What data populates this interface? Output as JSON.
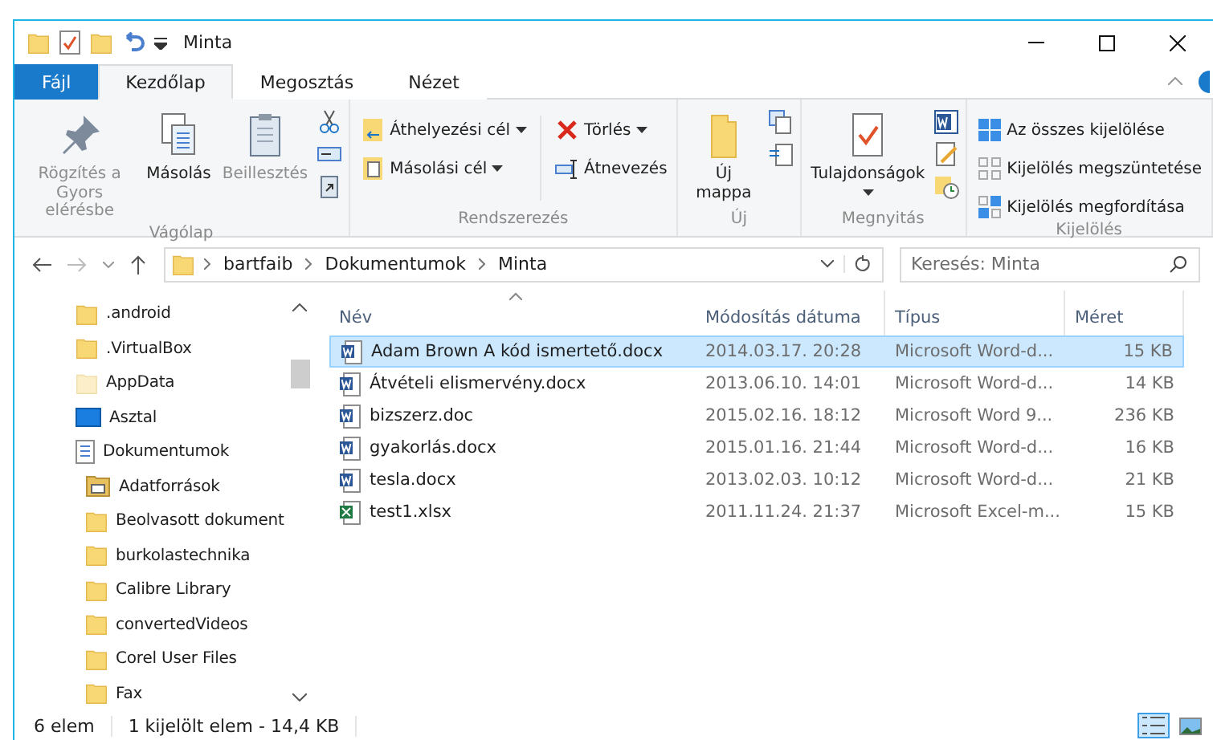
{
  "window": {
    "title": "Minta"
  },
  "tabs": [
    {
      "label": "Fájl",
      "kind": "file",
      "selected": false
    },
    {
      "label": "Kezdőlap",
      "kind": "tab",
      "selected": true
    },
    {
      "label": "Megosztás",
      "kind": "tab",
      "selected": false
    },
    {
      "label": "Nézet",
      "kind": "tab",
      "selected": false
    }
  ],
  "ribbon": [
    {
      "label": "Vágólap",
      "items": [
        {
          "kind": "large",
          "label": "Rögzítés a Gyors elérésbe",
          "disabled": true
        },
        {
          "kind": "large",
          "label": "Másolás",
          "disabled": false
        },
        {
          "kind": "large",
          "label": "Beillesztés",
          "disabled": true
        },
        {
          "kind": "iconstack"
        }
      ]
    },
    {
      "label": "Rendszerezés",
      "items": [
        {
          "kind": "small",
          "label": "Áthelyezési cél",
          "dropdown": true
        },
        {
          "kind": "small",
          "label": "Másolási cél",
          "dropdown": true
        },
        {
          "kind": "separator"
        },
        {
          "kind": "small",
          "label": "Törlés",
          "dropdown": true
        },
        {
          "kind": "small",
          "label": "Átnevezés",
          "dropdown": false
        }
      ]
    },
    {
      "label": "Új",
      "items": [
        {
          "kind": "large",
          "label": "Új mappa",
          "disabled": false
        },
        {
          "kind": "iconstack"
        }
      ]
    },
    {
      "label": "Megnyitás",
      "items": [
        {
          "kind": "large",
          "label": "Tulajdonságok",
          "disabled": false,
          "dropdown": true
        },
        {
          "kind": "iconstack"
        }
      ]
    },
    {
      "label": "Kijelölés",
      "items": [
        {
          "kind": "small",
          "label": "Az összes kijelölése",
          "dropdown": false
        },
        {
          "kind": "small",
          "label": "Kijelölés megszüntetése",
          "dropdown": false
        },
        {
          "kind": "small",
          "label": "Kijelölés megfordítása",
          "dropdown": false
        }
      ]
    }
  ],
  "address": {
    "path": [
      "bartfaib",
      "Dokumentumok",
      "Minta"
    ]
  },
  "search": {
    "placeholder": "Keresés: Minta"
  },
  "nav": [
    {
      "label": ".android",
      "kind": "folder"
    },
    {
      "label": ".VirtualBox",
      "kind": "folder"
    },
    {
      "label": "AppData",
      "kind": "hidden"
    },
    {
      "label": "Asztal",
      "kind": "desktop"
    },
    {
      "label": "Dokumentumok",
      "kind": "documents",
      "children": [
        {
          "label": "Adatforrások",
          "kind": "datasource"
        },
        {
          "label": "Beolvasott dokument",
          "kind": "folder"
        },
        {
          "label": "burkolastechnika",
          "kind": "folder"
        },
        {
          "label": "Calibre Library",
          "kind": "folder"
        },
        {
          "label": "convertedVideos",
          "kind": "folder"
        },
        {
          "label": "Corel User Files",
          "kind": "folder"
        },
        {
          "label": "Fax",
          "kind": "folder"
        }
      ]
    }
  ],
  "table": {
    "columns": [
      "Név",
      "Módosítás dátuma",
      "Típus",
      "Méret"
    ],
    "rows": [
      {
        "kind": "word",
        "cells": [
          "Adam Brown A kód ismertető.docx",
          "2014.03.17. 20:28",
          "Microsoft Word-d...",
          "15 KB"
        ],
        "selected": true
      },
      {
        "kind": "word",
        "cells": [
          "Átvételi elismervény.docx",
          "2013.06.10. 14:01",
          "Microsoft Word-d...",
          "14 KB"
        ],
        "selected": false
      },
      {
        "kind": "word",
        "cells": [
          "bizszerz.doc",
          "2015.02.16. 18:12",
          "Microsoft Word 9...",
          "236 KB"
        ],
        "selected": false
      },
      {
        "kind": "word",
        "cells": [
          "gyakorlás.docx",
          "2015.01.16. 21:44",
          "Microsoft Word-d...",
          "16 KB"
        ],
        "selected": false
      },
      {
        "kind": "word",
        "cells": [
          "tesla.docx",
          "2013.02.03. 10:12",
          "Microsoft Word-d...",
          "21 KB"
        ],
        "selected": false
      },
      {
        "kind": "excel",
        "cells": [
          "test1.xlsx",
          "2011.11.24. 21:37",
          "Microsoft Excel-m...",
          "15 KB"
        ],
        "selected": false
      }
    ]
  },
  "status_bar": {
    "items": [
      "6 elem",
      "1 kijelölt elem - 14,4 KB"
    ],
    "views": [
      {
        "kind": "details",
        "selected": true
      },
      {
        "kind": "large-icons",
        "selected": false
      }
    ]
  }
}
